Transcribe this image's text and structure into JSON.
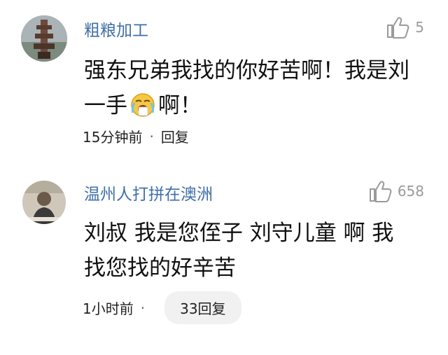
{
  "comments": [
    {
      "username": "粗粮加工",
      "likes": "5",
      "content_line1": "强东兄弟我找的你好苦啊！我是刘",
      "content_line2a": "一手",
      "content_line2b": "啊！",
      "time": "15分钟前",
      "separator": "·",
      "reply_label": "回复",
      "avatar_icon": "tower-avatar",
      "emoji_icon": "crying-emoji-icon"
    },
    {
      "username": "温州人打拼在澳洲",
      "likes": "658",
      "content_line1": "刘叔 我是您侄子 刘守儿童 啊 我",
      "content_line2": "找您找的好辛苦",
      "time": "1小时前",
      "separator": "·",
      "replies_label": "33回复",
      "avatar_icon": "person-avatar"
    }
  ],
  "colors": {
    "username": "#3f6fa8",
    "meta": "#9a9a9a",
    "pill_bg": "#f1f1f1"
  }
}
